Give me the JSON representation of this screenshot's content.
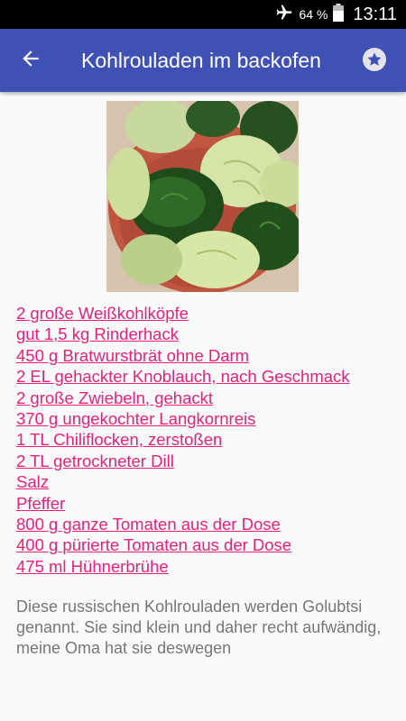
{
  "status_bar": {
    "battery_percent": "64 %",
    "time": "13:11",
    "icons": [
      "airplane-mode-icon",
      "battery-icon"
    ]
  },
  "app_bar": {
    "title": "Kohlrouladen im backofen",
    "back_icon": "arrow-back-icon",
    "favorite_icon": "star-icon",
    "color": "#3f51b5"
  },
  "recipe": {
    "image": "cabbage rolls photo",
    "link_color": "#e8207a",
    "ingredients": [
      "2 große Weißkohlköpfe",
      "gut 1,5 kg Rinderhack",
      "450 g Bratwurstbrät ohne Darm",
      "2 EL gehackter Knoblauch, nach Geschmack",
      "2 große Zwiebeln, gehackt",
      "370 g ungekochter Langkornreis",
      "1 TL Chiliflocken, zerstoßen",
      "2 TL getrockneter Dill",
      "Salz",
      "Pfeffer",
      "800 g ganze Tomaten aus der Dose",
      "400 g pürierte Tomaten aus der Dose",
      "475 ml Hühnerbrühe"
    ],
    "description": "Diese russischen Kohlrouladen werden Golubtsi genannt. Sie sind klein und daher recht aufwändig, meine Oma hat sie deswegen"
  }
}
